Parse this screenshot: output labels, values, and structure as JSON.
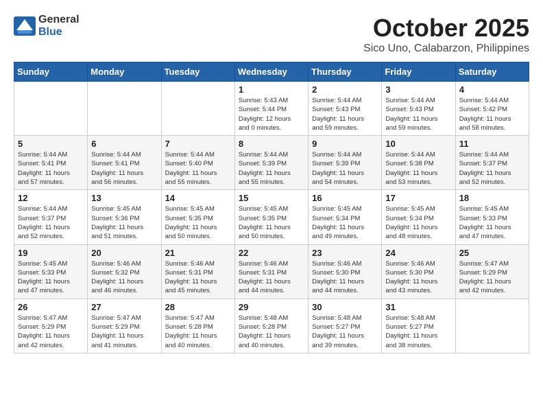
{
  "logo": {
    "general": "General",
    "blue": "Blue"
  },
  "title": "October 2025",
  "location": "Sico Uno, Calabarzon, Philippines",
  "weekdays": [
    "Sunday",
    "Monday",
    "Tuesday",
    "Wednesday",
    "Thursday",
    "Friday",
    "Saturday"
  ],
  "weeks": [
    [
      {
        "day": "",
        "info": ""
      },
      {
        "day": "",
        "info": ""
      },
      {
        "day": "",
        "info": ""
      },
      {
        "day": "1",
        "info": "Sunrise: 5:43 AM\nSunset: 5:44 PM\nDaylight: 12 hours\nand 0 minutes."
      },
      {
        "day": "2",
        "info": "Sunrise: 5:44 AM\nSunset: 5:43 PM\nDaylight: 11 hours\nand 59 minutes."
      },
      {
        "day": "3",
        "info": "Sunrise: 5:44 AM\nSunset: 5:43 PM\nDaylight: 11 hours\nand 59 minutes."
      },
      {
        "day": "4",
        "info": "Sunrise: 5:44 AM\nSunset: 5:42 PM\nDaylight: 11 hours\nand 58 minutes."
      }
    ],
    [
      {
        "day": "5",
        "info": "Sunrise: 5:44 AM\nSunset: 5:41 PM\nDaylight: 11 hours\nand 57 minutes."
      },
      {
        "day": "6",
        "info": "Sunrise: 5:44 AM\nSunset: 5:41 PM\nDaylight: 11 hours\nand 56 minutes."
      },
      {
        "day": "7",
        "info": "Sunrise: 5:44 AM\nSunset: 5:40 PM\nDaylight: 11 hours\nand 55 minutes."
      },
      {
        "day": "8",
        "info": "Sunrise: 5:44 AM\nSunset: 5:39 PM\nDaylight: 11 hours\nand 55 minutes."
      },
      {
        "day": "9",
        "info": "Sunrise: 5:44 AM\nSunset: 5:39 PM\nDaylight: 11 hours\nand 54 minutes."
      },
      {
        "day": "10",
        "info": "Sunrise: 5:44 AM\nSunset: 5:38 PM\nDaylight: 11 hours\nand 53 minutes."
      },
      {
        "day": "11",
        "info": "Sunrise: 5:44 AM\nSunset: 5:37 PM\nDaylight: 11 hours\nand 52 minutes."
      }
    ],
    [
      {
        "day": "12",
        "info": "Sunrise: 5:44 AM\nSunset: 5:37 PM\nDaylight: 11 hours\nand 52 minutes."
      },
      {
        "day": "13",
        "info": "Sunrise: 5:45 AM\nSunset: 5:36 PM\nDaylight: 11 hours\nand 51 minutes."
      },
      {
        "day": "14",
        "info": "Sunrise: 5:45 AM\nSunset: 5:35 PM\nDaylight: 11 hours\nand 50 minutes."
      },
      {
        "day": "15",
        "info": "Sunrise: 5:45 AM\nSunset: 5:35 PM\nDaylight: 11 hours\nand 50 minutes."
      },
      {
        "day": "16",
        "info": "Sunrise: 5:45 AM\nSunset: 5:34 PM\nDaylight: 11 hours\nand 49 minutes."
      },
      {
        "day": "17",
        "info": "Sunrise: 5:45 AM\nSunset: 5:34 PM\nDaylight: 11 hours\nand 48 minutes."
      },
      {
        "day": "18",
        "info": "Sunrise: 5:45 AM\nSunset: 5:33 PM\nDaylight: 11 hours\nand 47 minutes."
      }
    ],
    [
      {
        "day": "19",
        "info": "Sunrise: 5:45 AM\nSunset: 5:33 PM\nDaylight: 11 hours\nand 47 minutes."
      },
      {
        "day": "20",
        "info": "Sunrise: 5:46 AM\nSunset: 5:32 PM\nDaylight: 11 hours\nand 46 minutes."
      },
      {
        "day": "21",
        "info": "Sunrise: 5:46 AM\nSunset: 5:31 PM\nDaylight: 11 hours\nand 45 minutes."
      },
      {
        "day": "22",
        "info": "Sunrise: 5:46 AM\nSunset: 5:31 PM\nDaylight: 11 hours\nand 44 minutes."
      },
      {
        "day": "23",
        "info": "Sunrise: 5:46 AM\nSunset: 5:30 PM\nDaylight: 11 hours\nand 44 minutes."
      },
      {
        "day": "24",
        "info": "Sunrise: 5:46 AM\nSunset: 5:30 PM\nDaylight: 11 hours\nand 43 minutes."
      },
      {
        "day": "25",
        "info": "Sunrise: 5:47 AM\nSunset: 5:29 PM\nDaylight: 11 hours\nand 42 minutes."
      }
    ],
    [
      {
        "day": "26",
        "info": "Sunrise: 5:47 AM\nSunset: 5:29 PM\nDaylight: 11 hours\nand 42 minutes."
      },
      {
        "day": "27",
        "info": "Sunrise: 5:47 AM\nSunset: 5:29 PM\nDaylight: 11 hours\nand 41 minutes."
      },
      {
        "day": "28",
        "info": "Sunrise: 5:47 AM\nSunset: 5:28 PM\nDaylight: 11 hours\nand 40 minutes."
      },
      {
        "day": "29",
        "info": "Sunrise: 5:48 AM\nSunset: 5:28 PM\nDaylight: 11 hours\nand 40 minutes."
      },
      {
        "day": "30",
        "info": "Sunrise: 5:48 AM\nSunset: 5:27 PM\nDaylight: 11 hours\nand 39 minutes."
      },
      {
        "day": "31",
        "info": "Sunrise: 5:48 AM\nSunset: 5:27 PM\nDaylight: 11 hours\nand 38 minutes."
      },
      {
        "day": "",
        "info": ""
      }
    ]
  ]
}
